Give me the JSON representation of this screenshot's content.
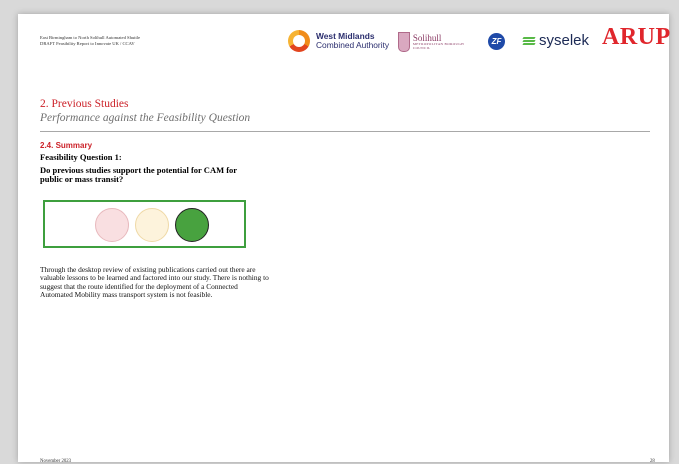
{
  "header": {
    "line1": "East Birmingham to North Solihull Automated Shuttle",
    "line2": "DRAFT Feasibility Report to Innovate UK / CCAV"
  },
  "logos": {
    "wmca_line1": "West Midlands",
    "wmca_line2": "Combined Authority",
    "solihull_name": "Solihull",
    "solihull_sub": "METROPOLITAN BOROUGH COUNCIL",
    "zf": "ZF",
    "syselek": "syselek",
    "arup": "ARUP"
  },
  "content": {
    "section_title": "2. Previous Studies",
    "subtitle": "Performance against the Feasibility Question",
    "sub_heading": "2.4. Summary",
    "fq_label": "Feasibility Question 1:",
    "fq_question": "Do previous studies support the potential for CAM for public or mass transit?",
    "body": "Through the desktop review of existing publications carried out there are valuable lessons to be learned and factored into our study. There is nothing to suggest that the route identified for the deployment of a Connected Automated Mobility mass transport system is not feasible."
  },
  "traffic_light": {
    "active": "green",
    "colors": {
      "red": "#f9dfe1",
      "amber": "#fdf3dc",
      "green": "#48a23f"
    }
  },
  "footer": {
    "date": "November 2023",
    "page": "28"
  }
}
